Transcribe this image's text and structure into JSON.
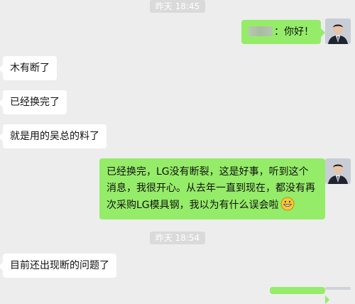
{
  "timestamps": [
    "昨天 18:45",
    "昨天 18:54"
  ],
  "messages": [
    {
      "side": "right",
      "prefix_redacted": true,
      "text": "：你好！"
    },
    {
      "side": "left",
      "text": "木有断了"
    },
    {
      "side": "left",
      "text": "已经换完了"
    },
    {
      "side": "left",
      "text": "就是用的吴总的料了"
    },
    {
      "side": "right",
      "text": "已经换完，LG没有断裂，这是好事，听到这个消息，我很开心。从去年一直到现在，都没有再次采购LG模具钢，我以为有什么误会啦",
      "emoji": "grinning-face-icon"
    },
    {
      "side": "left",
      "text": "目前还出现断的问题了"
    }
  ],
  "colors": {
    "background": "#ededed",
    "sent_bubble": "#95ec69",
    "received_bubble": "#ffffff",
    "timestamp_bg": "#dadada"
  },
  "icons": {
    "avatar": "user-avatar-icon"
  }
}
